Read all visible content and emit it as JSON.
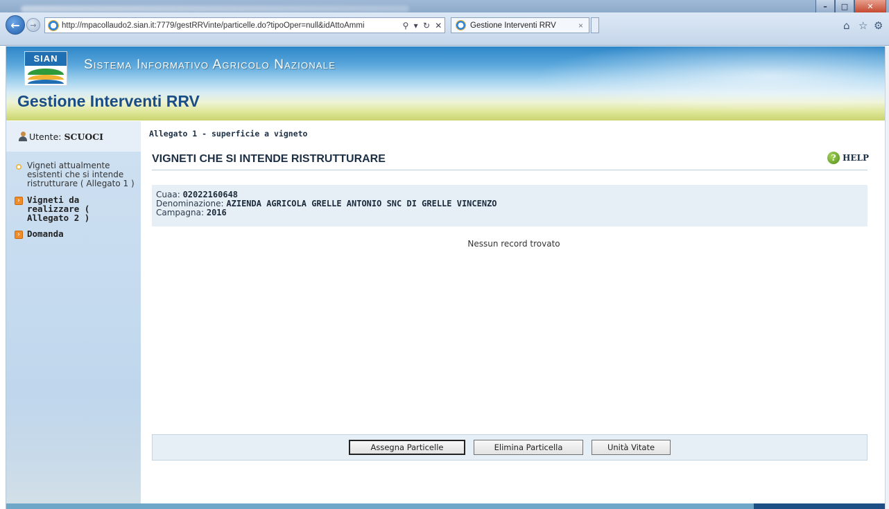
{
  "browser": {
    "url": "http://mpacollaudo2.sian.it:7779/gestRRVinte/particelle.do?tipoOper=null&idAttoAmmi",
    "tab_title": "Gestione Interventi RRV",
    "window_controls": {
      "minimize": "–",
      "maximize": "□",
      "close": "✕"
    },
    "address_tools": [
      "⚲",
      "▾",
      "↻",
      "✕"
    ],
    "right_icons": [
      "⌂",
      "☆",
      "⚙"
    ]
  },
  "header": {
    "logo_text": "SIAN",
    "system_name": "Sistema Informativo Agricolo Nazionale",
    "app_title": "Gestione Interventi RRV"
  },
  "sidebar": {
    "user_label": "Utente:",
    "user_name": "SCUOCI",
    "items": [
      {
        "label": "Vigneti attualmente esistenti che si intende ristrutturare ( Allegato 1 )",
        "icon": "sun-bullet-icon",
        "active": true
      },
      {
        "label": "Vigneti da realizzare ( Allegato 2 )",
        "icon": "orange-arrow-icon",
        "active": false
      },
      {
        "label": "Domanda",
        "icon": "orange-arrow-icon",
        "active": false
      }
    ]
  },
  "main": {
    "breadcrumb": "Allegato 1 - superficie a vigneto",
    "section_title": "VIGNETI CHE SI INTENDE RISTRUTTURARE",
    "help_label": "HELP",
    "info": {
      "cuaa_label": "Cuaa:",
      "cuaa_value": "02022160648",
      "denominazione_label": "Denominazione:",
      "denominazione_value": "AZIENDA AGRICOLA GRELLE ANTONIO SNC DI GRELLE VINCENZO",
      "campagna_label": "Campagna:",
      "campagna_value": "2016"
    },
    "no_records": "Nessun record trovato",
    "buttons": {
      "assegna": "Assegna Particelle",
      "elimina": "Elimina Particella",
      "unita": "Unità Vitate"
    }
  },
  "colors": {
    "accent_blue": "#1a4d86",
    "sidebar_bg": "#c3d9ee",
    "info_bg": "#e7eff6",
    "menu_bullet": "#f08d2a"
  }
}
